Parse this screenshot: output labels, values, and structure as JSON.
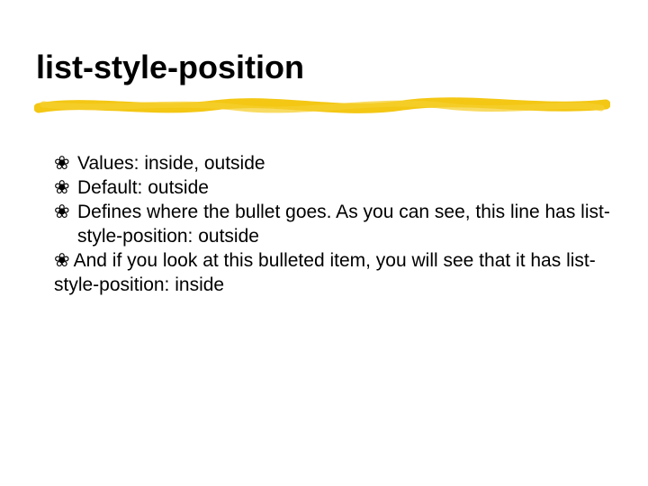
{
  "title": "list-style-position",
  "bullet_char": "❀",
  "items": [
    "Values: inside, outside",
    "Default: outside",
    "Defines where the bullet goes. As you can see, this line has list-style-position: outside",
    "And if you look at this bulleted item, you will see that it has list-style-position: inside"
  ]
}
